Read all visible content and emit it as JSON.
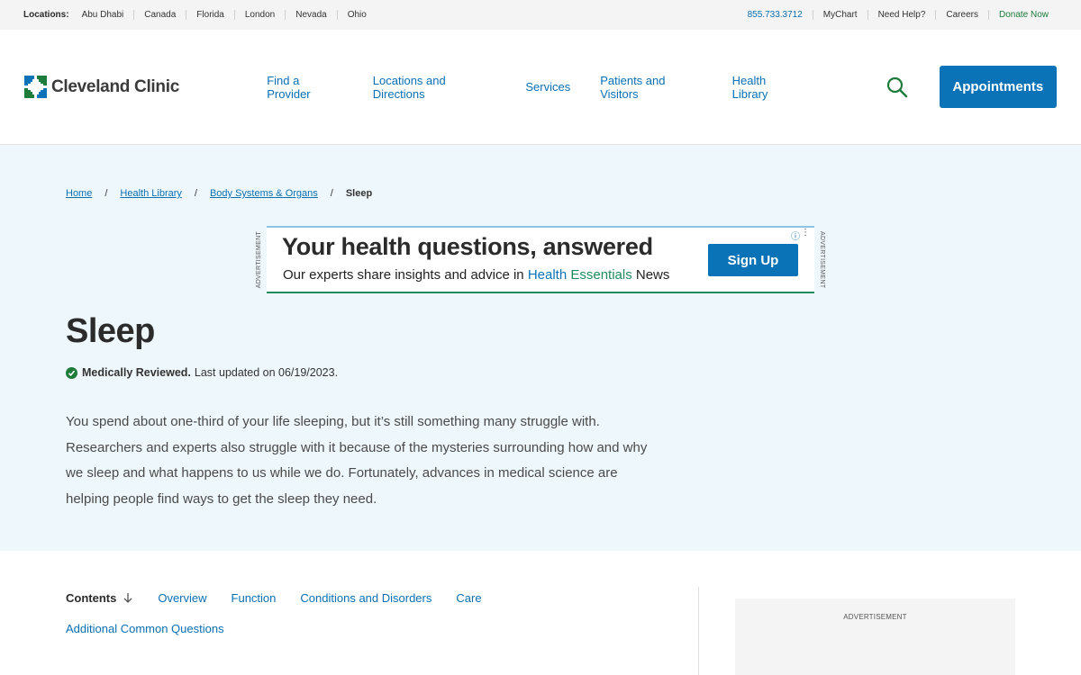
{
  "utility": {
    "locations_label": "Locations:",
    "locations": [
      "Abu Dhabi",
      "Canada",
      "Florida",
      "London",
      "Nevada",
      "Ohio"
    ],
    "phone": "855.733.3712",
    "mychart": "MyChart",
    "need_help": "Need Help?",
    "careers": "Careers",
    "donate": "Donate Now"
  },
  "header": {
    "logo_text": "Cleveland Clinic",
    "nav": [
      "Find a Provider",
      "Locations and Directions",
      "Services",
      "Patients and Visitors",
      "Health Library"
    ],
    "appointments": "Appointments"
  },
  "breadcrumb": {
    "items": [
      "Home",
      "Health Library",
      "Body Systems & Organs"
    ],
    "separator": "/",
    "current": "Sleep"
  },
  "ad_banner": {
    "side_label": "ADVERTISEMENT",
    "headline": "Your health questions, answered",
    "sub_prefix": "Our experts share insights and advice in ",
    "sub_highlight1": "Health ",
    "sub_highlight2": "Essentials",
    "sub_suffix": " News",
    "cta": "Sign Up"
  },
  "article": {
    "title": "Sleep",
    "reviewed_label": "Medically Reviewed.",
    "updated": "Last updated on 06/19/2023.",
    "intro": "You spend about one-third of your life sleeping, but it’s still something many struggle with. Researchers and experts also struggle with it because of the mysteries surrounding how and why we sleep and what happens to us while we do. Fortunately, advances in medical science are helping people find ways to get the sleep they need."
  },
  "contents": {
    "label": "Contents",
    "links": [
      "Overview",
      "Function",
      "Conditions and Disorders",
      "Care",
      "Additional Common Questions"
    ]
  },
  "side_ad": {
    "label": "ADVERTISEMENT"
  },
  "colors": {
    "brand_blue": "#0a73b8",
    "brand_green": "#1d7c3a",
    "hero_bg": "#eef7fc"
  }
}
